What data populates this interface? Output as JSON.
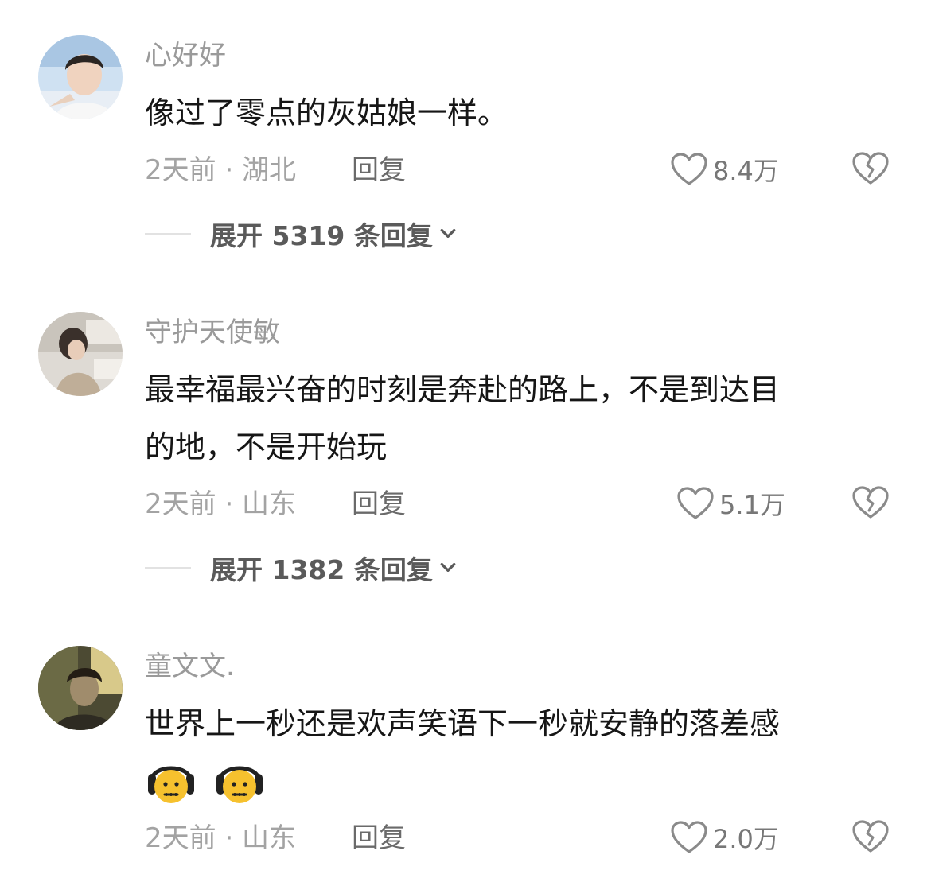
{
  "comments": [
    {
      "username": "心好好",
      "content": "像过了零点的灰姑娘一样。",
      "meta": "2天前 · 湖北",
      "reply": "回复",
      "likes": "8.4万",
      "expand": "展开 5319 条回复"
    },
    {
      "username": "守护天使敏",
      "content_line1": "最幸福最兴奋的时刻是奔赴的路上，不是到达目",
      "content_line2": "的地，不是开始玩",
      "meta": "2天前 · 山东",
      "reply": "回复",
      "likes": "5.1万",
      "expand": "展开 1382 条回复"
    },
    {
      "username": "童文文.",
      "content_line1": "世界上一秒还是欢声笑语下一秒就安静的落差感",
      "emojis": [
        "headphones-sad-face-emoji",
        "headphones-sad-face-emoji"
      ],
      "meta": "2天前 · 山东",
      "reply": "回复",
      "likes": "2.0万"
    }
  ],
  "colors": {
    "background": "#ffffff",
    "username": "#9a9a9a",
    "content": "#161616",
    "meta": "#a3a3a3",
    "expand": "#5a5a5a"
  }
}
